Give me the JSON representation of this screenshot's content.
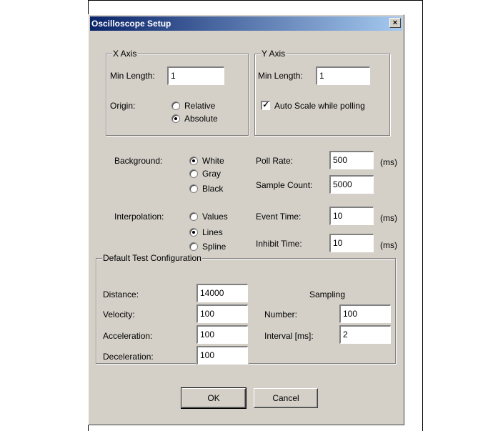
{
  "dialog": {
    "title": "Oscilloscope Setup",
    "close_label": "×"
  },
  "x_axis": {
    "title": "X Axis",
    "min_length_label": "Min Length:",
    "min_length_value": "1",
    "origin_label": "Origin:",
    "origin_options": [
      "Relative",
      "Absolute"
    ],
    "origin_selected": "Absolute"
  },
  "y_axis": {
    "title": "Y Axis",
    "min_length_label": "Min Length:",
    "min_length_value": "1",
    "autoscale_label": "Auto Scale while polling",
    "autoscale_checked": true,
    "check_mark": "✓"
  },
  "background": {
    "label": "Background:",
    "options": [
      "White",
      "Gray",
      "Black"
    ],
    "selected": "White"
  },
  "interpolation": {
    "label": "Interpolation:",
    "options": [
      "Values",
      "Lines",
      "Spline"
    ],
    "selected": "Lines"
  },
  "poll_rate": {
    "label": "Poll Rate:",
    "value": "500",
    "unit": "(ms)"
  },
  "sample_count": {
    "label": "Sample Count:",
    "value": "5000"
  },
  "event_time": {
    "label": "Event Time:",
    "value": "10",
    "unit": "(ms)"
  },
  "inhibit_time": {
    "label": "Inhibit Time:",
    "value": "10",
    "unit": "(ms)"
  },
  "default_test": {
    "title": "Default Test Configuration",
    "distance": {
      "label": "Distance:",
      "value": "14000"
    },
    "velocity": {
      "label": "Velocity:",
      "value": "100"
    },
    "acceleration": {
      "label": "Acceleration:",
      "value": "100"
    },
    "deceleration": {
      "label": "Deceleration:",
      "value": "100"
    },
    "sampling_title": "Sampling",
    "number": {
      "label": "Number:",
      "value": "100"
    },
    "interval": {
      "label": "Interval [ms]:",
      "value": "2"
    }
  },
  "buttons": {
    "ok": "OK",
    "cancel": "Cancel"
  }
}
